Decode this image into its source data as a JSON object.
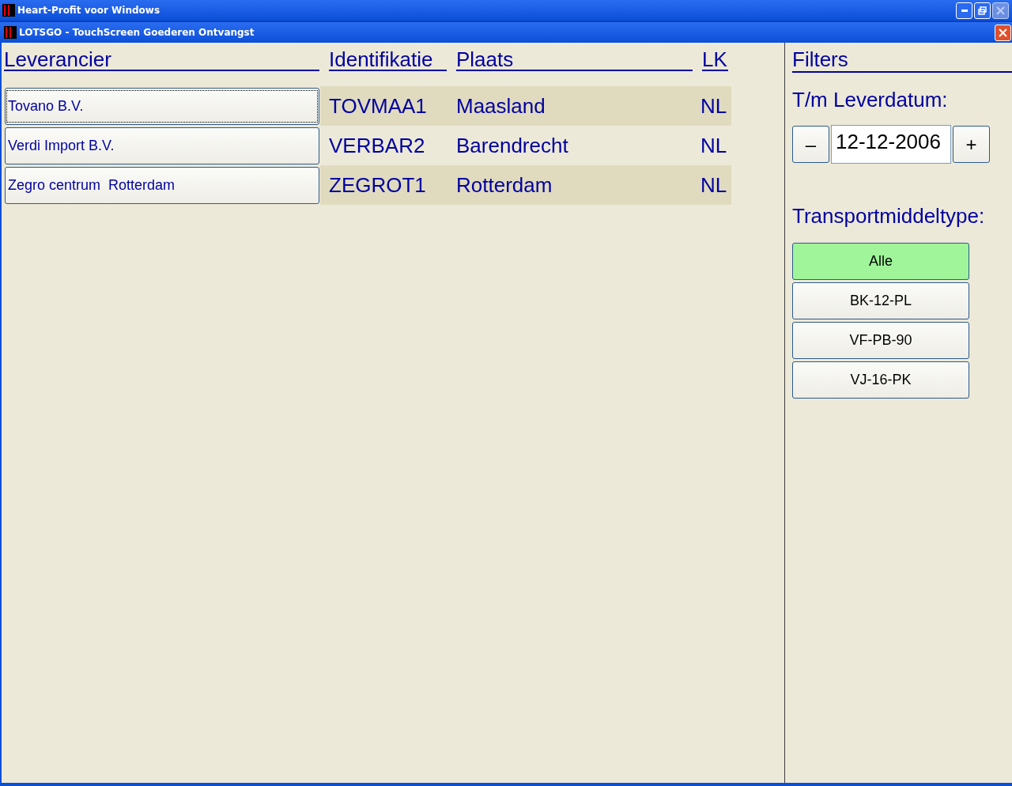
{
  "app_window": {
    "title": "Heart-Profit voor Windows"
  },
  "child_window": {
    "title": "LOTSGO - TouchScreen Goederen Ontvangst"
  },
  "table": {
    "columns": [
      "Leverancier",
      "Identifikatie",
      "Plaats",
      "LK"
    ],
    "rows": [
      {
        "supplier": "Tovano B.V.",
        "identification": "TOVMAA1",
        "place": "Maasland",
        "country": "NL",
        "focused": true
      },
      {
        "supplier": "Verdi Import B.V.",
        "identification": "VERBAR2",
        "place": "Barendrecht",
        "country": "NL",
        "focused": false
      },
      {
        "supplier": "Zegro centrum  Rotterdam",
        "identification": "ZEGROT1",
        "place": "Rotterdam",
        "country": "NL",
        "focused": false
      }
    ]
  },
  "filters": {
    "title": "Filters",
    "date_label": "T/m Leverdatum:",
    "decrement": "–",
    "date_value": "12-12-2006",
    "increment": "+",
    "transport_label": "Transportmiddeltype:",
    "transport_options": [
      {
        "label": "Alle",
        "selected": true
      },
      {
        "label": "BK-12-PL",
        "selected": false
      },
      {
        "label": "VF-PB-90",
        "selected": false
      },
      {
        "label": "VJ-16-PK",
        "selected": false
      }
    ]
  }
}
